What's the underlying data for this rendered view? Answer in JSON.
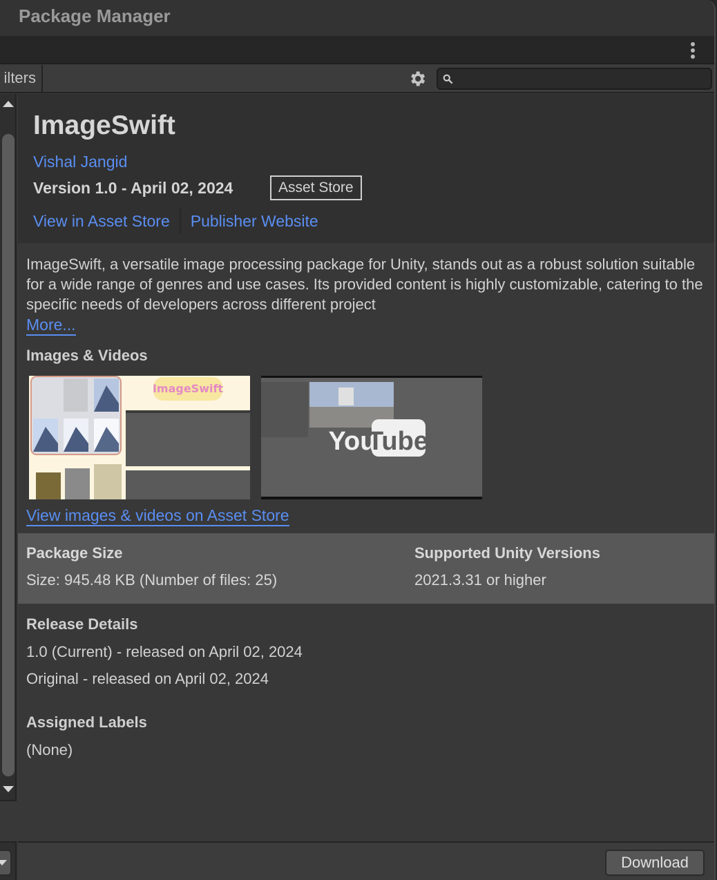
{
  "window": {
    "title": "Package Manager"
  },
  "toolbar": {
    "filters_label": "ilters",
    "search": {
      "value": "",
      "placeholder": ""
    },
    "icons": {
      "more": "kebab-menu-icon",
      "settings": "gear-icon",
      "search": "magnifier-icon"
    }
  },
  "package": {
    "name": "ImageSwift",
    "author": "Vishal Jangid",
    "version_line": "Version 1.0 - April 02, 2024",
    "source_badge": "Asset Store",
    "links": {
      "view_store": "View in Asset Store",
      "publisher": "Publisher Website"
    },
    "description": "ImageSwift, a versatile image processing package for Unity, stands out as a robust solution suitable for a wide range of genres and use cases. Its provided content is highly customizable, catering to the specific needs of developers across different project",
    "more_label": "More..."
  },
  "media": {
    "heading": "Images & Videos",
    "thumbnails": [
      {
        "kind": "image",
        "caption": "ImageSwift"
      },
      {
        "kind": "video",
        "caption": "YouTube"
      }
    ],
    "view_link": "View images & videos on Asset Store"
  },
  "size": {
    "heading": "Package Size",
    "value": "Size: 945.48 KB (Number of files: 25)"
  },
  "unity_versions": {
    "heading": "Supported Unity Versions",
    "value": "2021.3.31 or higher"
  },
  "release": {
    "heading": "Release Details",
    "lines": [
      "1.0 (Current) - released on April 02, 2024",
      "Original - released on April 02, 2024"
    ]
  },
  "labels": {
    "heading": "Assigned Labels",
    "value": "(None)"
  },
  "footer": {
    "download_label": "Download"
  },
  "colors": {
    "link": "#5a8ef2",
    "panel": "#383838",
    "header": "#303030",
    "size_panel": "#585858"
  }
}
